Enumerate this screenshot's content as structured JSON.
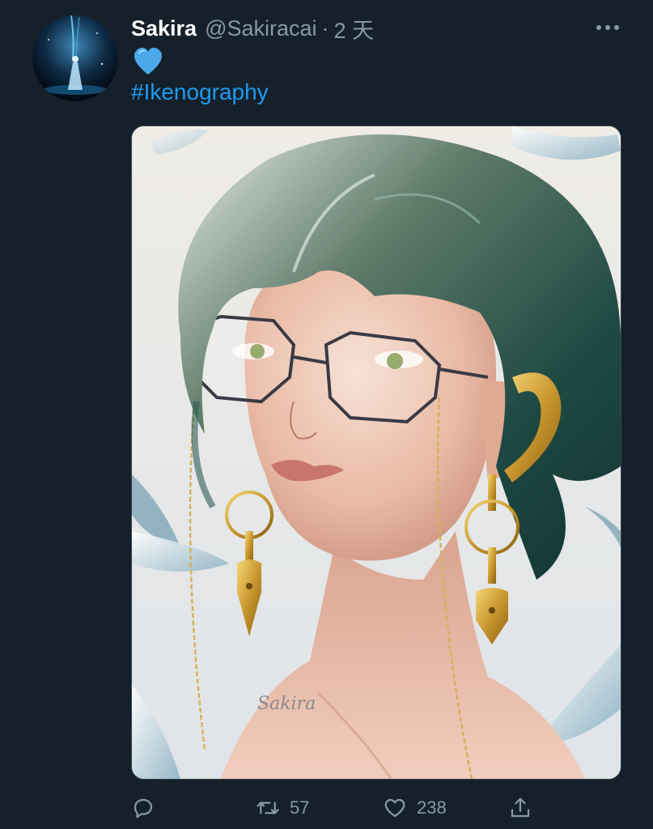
{
  "tweet": {
    "display_name": "Sakira",
    "handle": "@Sakiracai",
    "separator": "·",
    "timestamp": "2 天",
    "text_emoji": "💙",
    "hashtag": "#Ikenography",
    "image_signature": "Sakira"
  },
  "actions": {
    "reply_count": "",
    "retweet_count": "57",
    "like_count": "238"
  },
  "icons": {
    "more": "more-horizontal-icon",
    "reply": "reply-icon",
    "retweet": "retweet-icon",
    "like": "heart-icon",
    "share": "share-icon",
    "emoji": "blue-heart-emoji"
  },
  "colors": {
    "background": "#15202b",
    "text_primary": "#ffffff",
    "text_secondary": "#8899a6",
    "link": "#1d9bf0",
    "emoji_blue": "#4aa8e8"
  }
}
